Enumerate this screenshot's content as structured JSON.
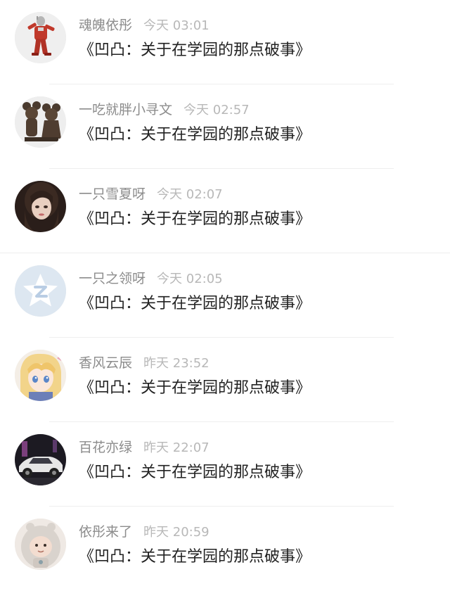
{
  "comments": [
    {
      "username": "魂魄依彤",
      "time": "今天 03:01",
      "message": "《凹凸：关于在学园的那点破事》",
      "avatar": "ultraman-figure-avatar"
    },
    {
      "username": "一吃就胖小寻文",
      "time": "今天 02:57",
      "message": "《凹凸：关于在学园的那点破事》",
      "avatar": "mickey-minnie-statue-avatar"
    },
    {
      "username": "一只雪夏呀",
      "time": "今天 02:07",
      "message": "《凹凸：关于在学园的那点破事》",
      "avatar": "girl-portrait-avatar"
    },
    {
      "username": "一只之领呀",
      "time": "今天 02:05",
      "message": "《凹凸：关于在学园的那点破事》",
      "avatar": "qzone-default-avatar"
    },
    {
      "username": "香风云辰",
      "time": "昨天 23:52",
      "message": "《凹凸：关于在学园的那点破事》",
      "avatar": "anime-girl-avatar"
    },
    {
      "username": "百花亦绿",
      "time": "昨天 22:07",
      "message": "《凹凸：关于在学园的那点破事》",
      "avatar": "sports-car-avatar"
    },
    {
      "username": "依彤来了",
      "time": "昨天 20:59",
      "message": "《凹凸：关于在学园的那点破事》",
      "avatar": "baby-in-hood-avatar"
    }
  ],
  "colors": {
    "username": "#8c8c8c",
    "time": "#b8b8b8",
    "message": "#222222",
    "divider": "#eeeeee",
    "qzone_blue": "#b9cde4"
  }
}
